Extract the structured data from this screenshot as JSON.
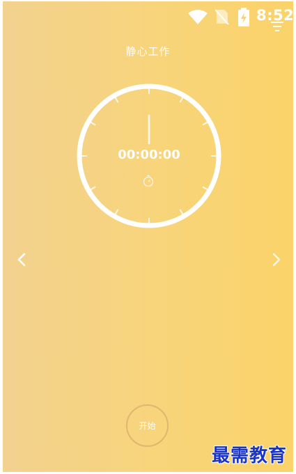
{
  "status_bar": {
    "time": "8:52",
    "icons": [
      "wifi-icon",
      "no-sim-icon",
      "battery-charging-icon"
    ]
  },
  "header": {
    "title": "静心工作",
    "menu_icon": "menu-icon"
  },
  "timer": {
    "display": "00:00:00",
    "icon": "timer-icon"
  },
  "navigation": {
    "prev_icon": "chevron-left-icon",
    "next_icon": "chevron-right-icon"
  },
  "controls": {
    "start_label": "开始"
  },
  "watermark": {
    "text": "最需教育"
  },
  "colors": {
    "background_start": "#f2d28f",
    "background_end": "#fbd36a",
    "ring": "#ffffff",
    "button_border": "#e0b670",
    "watermark": "#1a33c8"
  }
}
